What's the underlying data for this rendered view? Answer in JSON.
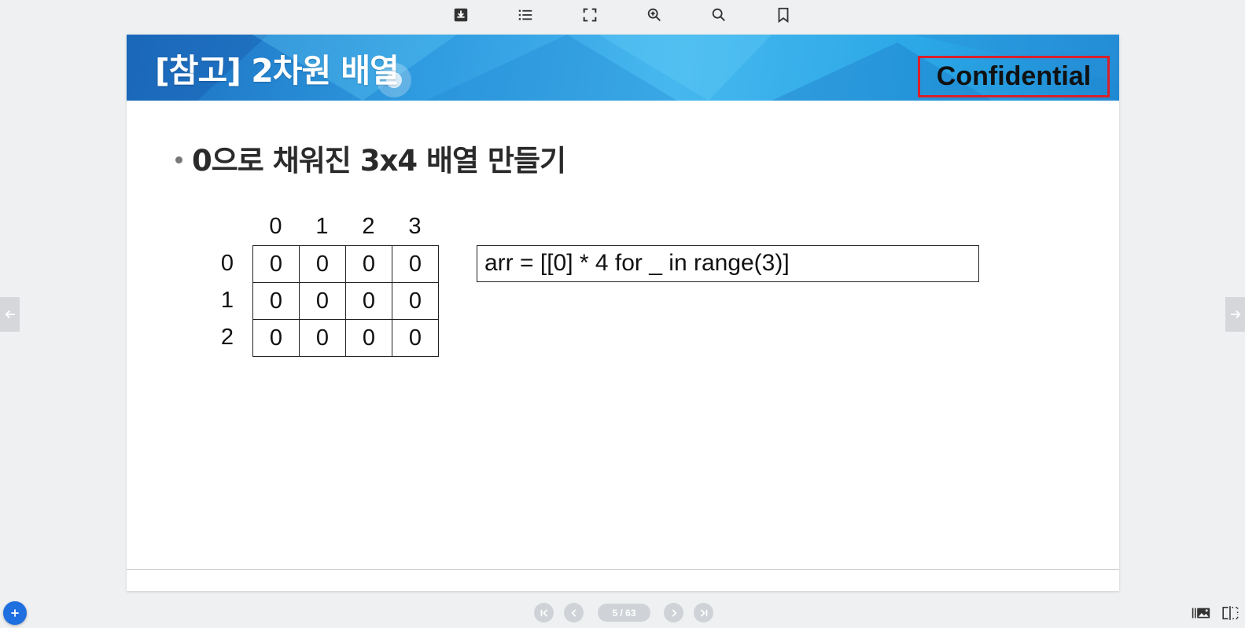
{
  "toolbar": {
    "icons": [
      "download-icon",
      "list-icon",
      "fullscreen-icon",
      "zoom-in-icon",
      "search-icon",
      "bookmark-icon"
    ]
  },
  "slide": {
    "title": "[참고] 2차원 배열",
    "badge": "Confidential",
    "bullet": "0으로 채워진 3x4 배열 만들기",
    "column_indices": [
      "0",
      "1",
      "2",
      "3"
    ],
    "row_indices": [
      "0",
      "1",
      "2"
    ],
    "grid": [
      [
        "0",
        "0",
        "0",
        "0"
      ],
      [
        "0",
        "0",
        "0",
        "0"
      ],
      [
        "0",
        "0",
        "0",
        "0"
      ]
    ],
    "code": "arr = [[0] * 4 for _ in range(3)]"
  },
  "pager": {
    "label": "5 / 63"
  },
  "colors": {
    "header_blue": "#2f9be0",
    "badge_border": "#d9202a",
    "add_button": "#1e6fe0"
  }
}
